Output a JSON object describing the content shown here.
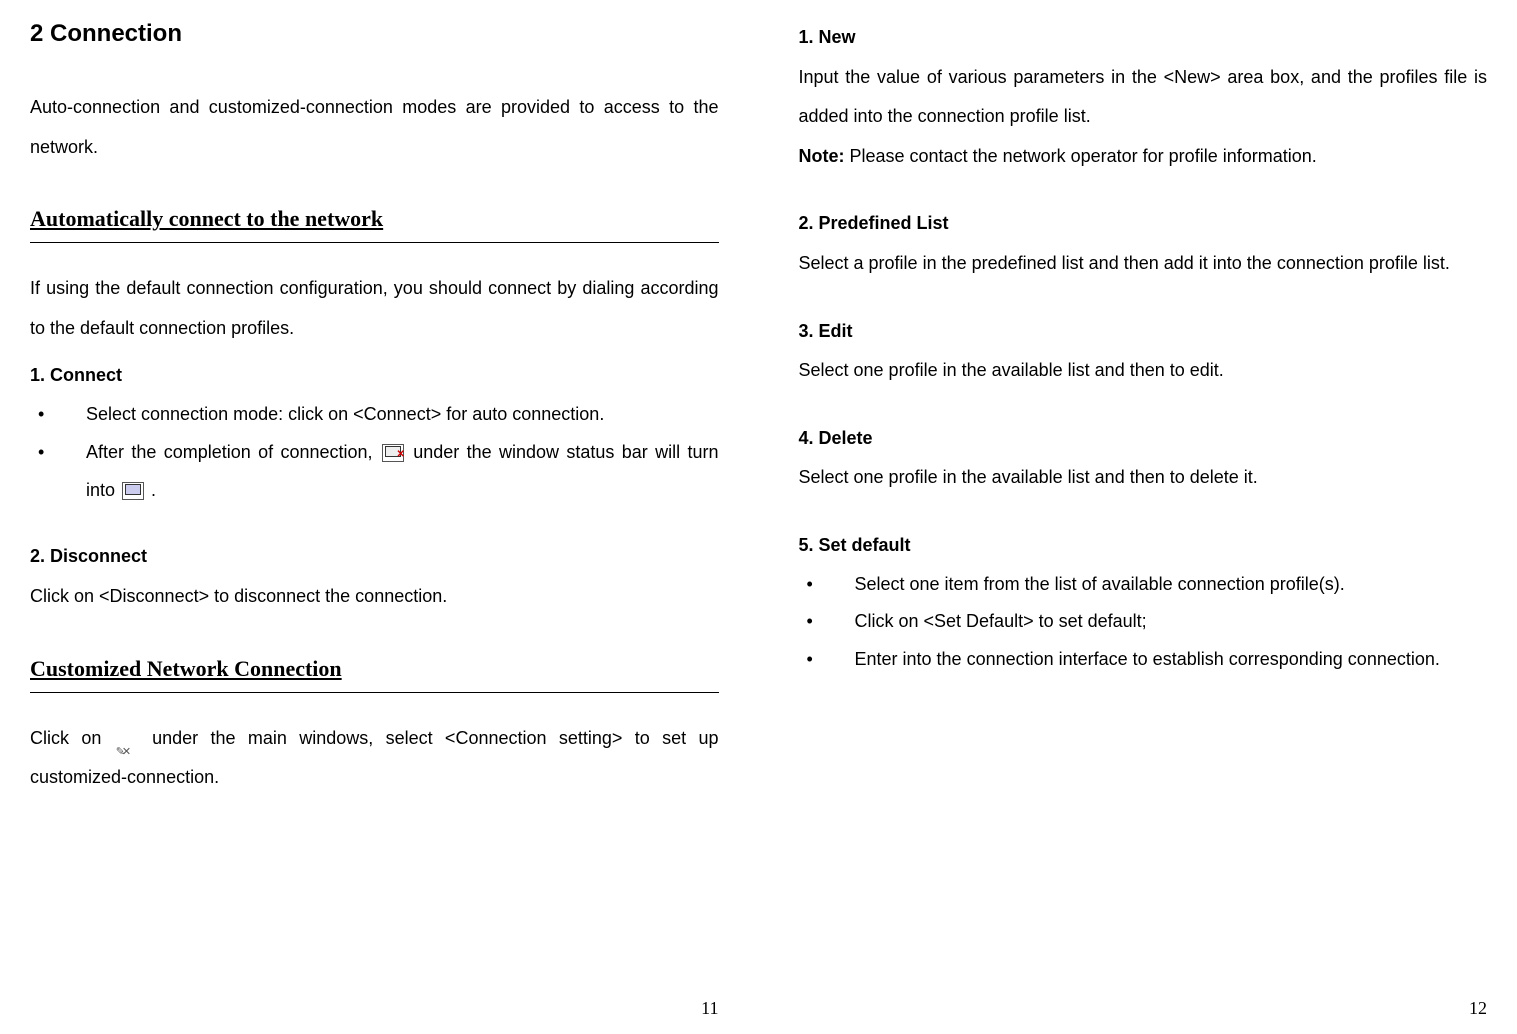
{
  "left": {
    "title": "2 Connection",
    "intro": "Auto-connection and customized-connection modes are provided to access to the network.",
    "heading_auto": "Automatically connect to the network",
    "auto_intro": "If using the default connection configuration, you should connect by dialing according to the default connection profiles.",
    "connect_heading": "1. Connect",
    "connect_b1": "Select connection mode: click on <Connect> for auto connection.",
    "connect_b2a": "After the completion of connection, ",
    "connect_b2b": " under the window status bar will turn into ",
    "connect_b2c": " .",
    "disconnect_heading": "2. Disconnect",
    "disconnect_text": "Click on <Disconnect> to disconnect the connection.",
    "heading_custom": "Customized Network Connection",
    "custom_intro_a": "Click on ",
    "custom_intro_b": " under the main windows, select <Connection setting> to set up customized-connection.",
    "page_num": "11"
  },
  "right": {
    "new_heading": "1. New",
    "new_text": "Input the value of various parameters in the <New> area box, and the profiles file is added into the connection profile list.",
    "note_label": "Note:",
    "note_text": " Please contact the network operator for profile information.",
    "pre_heading": "2. Predefined List",
    "pre_text": "Select a profile in the predefined list and then add it into the connection profile list.",
    "edit_heading": "3. Edit",
    "edit_text": "Select one profile in the available list and then to edit.",
    "del_heading": "4. Delete",
    "del_text": "Select one profile in the available list and then to delete it.",
    "set_heading": "5. Set default",
    "set_b1": "Select one item from the list of available connection profile(s).",
    "set_b2": "Click on <Set Default> to set default;",
    "set_b3": "Enter into the connection interface to establish corresponding connection.",
    "page_num": "12"
  }
}
